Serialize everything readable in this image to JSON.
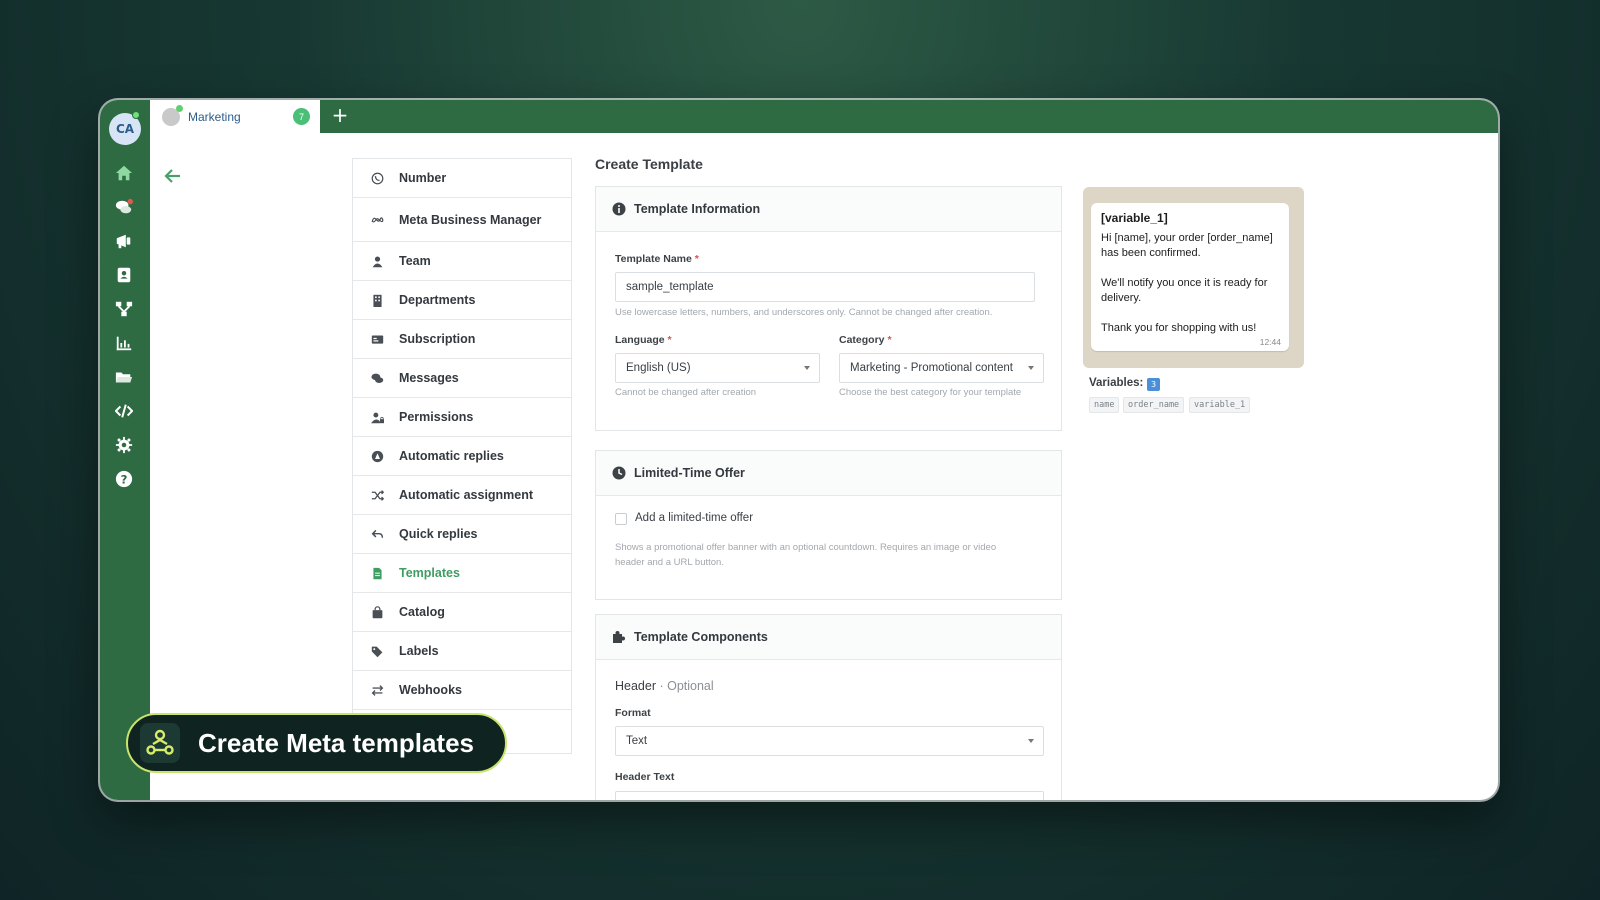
{
  "rail": {
    "avatar_initials": "CA",
    "icons": [
      "home-icon",
      "chats-icon",
      "campaigns-icon",
      "contacts-icon",
      "flows-icon",
      "reports-icon",
      "files-icon",
      "developer-icon",
      "settings-icon",
      "help-icon"
    ]
  },
  "tabs": {
    "active_label": "Marketing",
    "badge": "7",
    "add_label": "+"
  },
  "settings_menu": [
    {
      "label": "Number",
      "icon": "whatsapp-icon"
    },
    {
      "label": "Meta Business Manager",
      "icon": "meta-icon"
    },
    {
      "label": "Team",
      "icon": "user-icon"
    },
    {
      "label": "Departments",
      "icon": "building-icon"
    },
    {
      "label": "Subscription",
      "icon": "card-icon"
    },
    {
      "label": "Messages",
      "icon": "comments-icon"
    },
    {
      "label": "Permissions",
      "icon": "user-lock-icon"
    },
    {
      "label": "Automatic replies",
      "icon": "robot-icon"
    },
    {
      "label": "Automatic assignment",
      "icon": "shuffle-icon"
    },
    {
      "label": "Quick replies",
      "icon": "reply-icon"
    },
    {
      "label": "Templates",
      "icon": "file-icon",
      "active": true
    },
    {
      "label": "Catalog",
      "icon": "bag-icon"
    },
    {
      "label": "Labels",
      "icon": "tags-icon"
    },
    {
      "label": "Webhooks",
      "icon": "exchange-icon"
    }
  ],
  "main": {
    "title": "Create Template",
    "template_info": {
      "heading": "Template Information",
      "name_label": "Template Name",
      "name_value": "sample_template",
      "name_help": "Use lowercase letters, numbers, and underscores only. Cannot be changed after creation.",
      "language_label": "Language",
      "language_value": "English (US)",
      "language_help": "Cannot be changed after creation",
      "category_label": "Category",
      "category_value": "Marketing - Promotional content",
      "category_help": "Choose the best category for your template",
      "required_mark": "*"
    },
    "limited_offer": {
      "heading": "Limited-Time Offer",
      "checkbox_label": "Add a limited-time offer",
      "help": "Shows a promotional offer banner with an optional countdown. Requires an image or video header and a URL button."
    },
    "components": {
      "heading": "Template Components",
      "header_label": "Header",
      "header_optional": " · Optional",
      "format_label": "Format",
      "format_value": "Text",
      "header_text_label": "Header Text"
    }
  },
  "preview": {
    "title": "[variable_1]",
    "line1": "Hi [name], your order [order_name] has been confirmed.",
    "line2": "We'll notify you once it is ready for delivery.",
    "line3": "Thank you for shopping with us!",
    "time": "12:44",
    "variables_label": "Variables:",
    "variables_count": "3",
    "variables": [
      "name",
      "order_name",
      "variable_1"
    ]
  },
  "promo": {
    "text": "Create Meta templates"
  },
  "colors": {
    "brand_green": "#2e6b43",
    "accent_green": "#3f9d62",
    "promo_border": "#c9e36b"
  }
}
